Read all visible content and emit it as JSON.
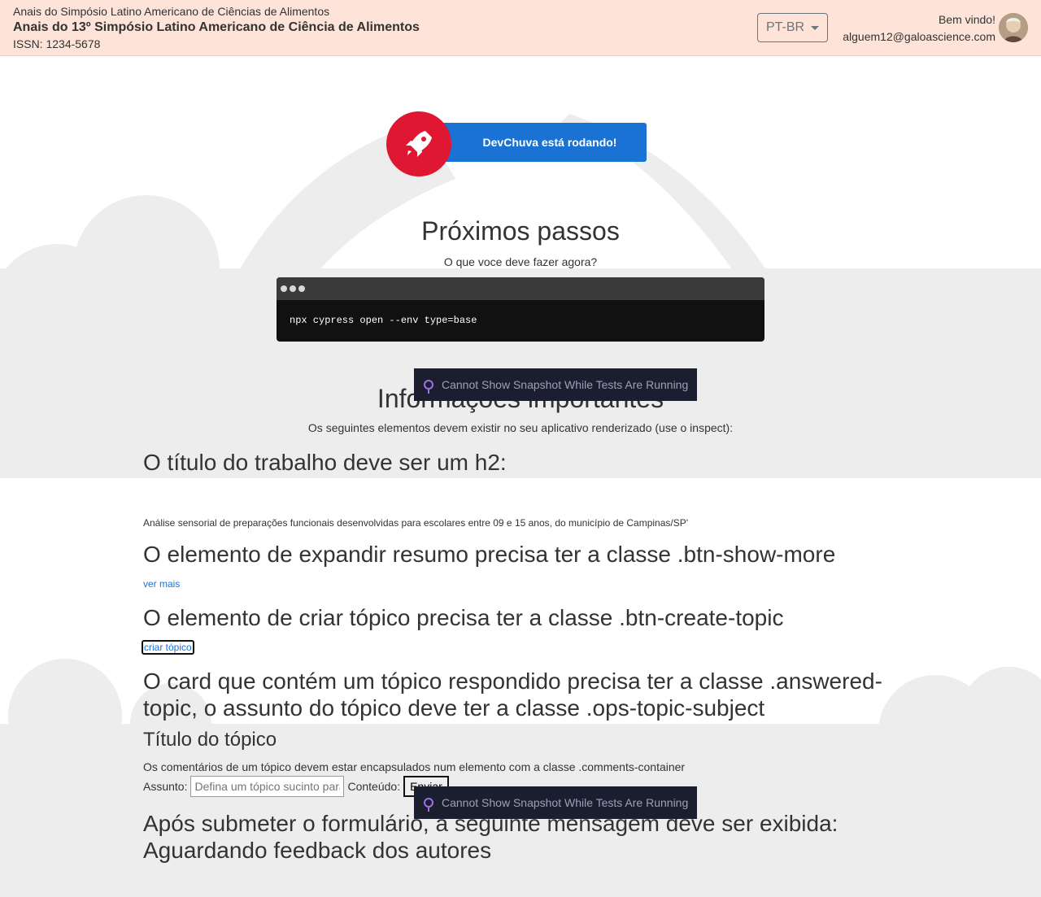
{
  "header": {
    "event_line": "Anais do Simpósio Latino Americano de Ciências de Alimentos",
    "event_title": "Anais do 13º Simpósio Latino Americano de Ciência de Alimentos",
    "issn": "ISSN: 1234-5678",
    "language": "PT-BR",
    "welcome": "Bem vindo!",
    "email": "alguem12@galoascience.com"
  },
  "hero": {
    "running": "DevChuva está rodando!"
  },
  "next_steps": {
    "title": "Próximos passos",
    "subtitle": "O que voce deve fazer agora?",
    "command": "npx cypress open --env type=base"
  },
  "info": {
    "title": "Informações importantes",
    "subtitle": "Os seguintes elementos devem existir no seu aplicativo renderizado (use o inspect):",
    "h2_title_rule": "O título do trabalho deve ser um h2:",
    "work_title": "Análise sensorial de preparações funcionais desenvolvidas para escolares entre 09 e 15 anos, do município de Campinas/SP'",
    "show_more_rule": "O elemento de expandir resumo precisa ter a classe .btn-show-more",
    "show_more_link": "ver mais",
    "create_topic_rule": "O elemento de criar tópico precisa ter a classe .btn-create-topic",
    "create_topic_link": "criar tópico",
    "answered_rule_1": "O card que contém um tópico respondido precisa ter a classe .answered-",
    "answered_rule_2": "topic, o assunto do tópico deve ter a classe .ops-topic-subject",
    "topic_title": "Título do tópico",
    "comments_rule": "Os comentários de um tópico devem estar encapsulados num elemento com a classe .comments-container",
    "subject_label": "Assunto:",
    "subject_placeholder": "Defina um tópico sucinto para",
    "content_label": "Conteúdo:",
    "submit_label": "Enviar",
    "after_submit_1": "Após submeter o formulário, a seguinte mensagem deve ser exibida:",
    "after_submit_2": "Aguardando feedback dos autores"
  },
  "overlays": {
    "snapshot_msg": "Cannot Show Snapshot While Tests Are Running"
  },
  "colors": {
    "header_bg": "#fde3d8",
    "accent_blue": "#1a73d4",
    "rocket_red": "#e01733"
  }
}
